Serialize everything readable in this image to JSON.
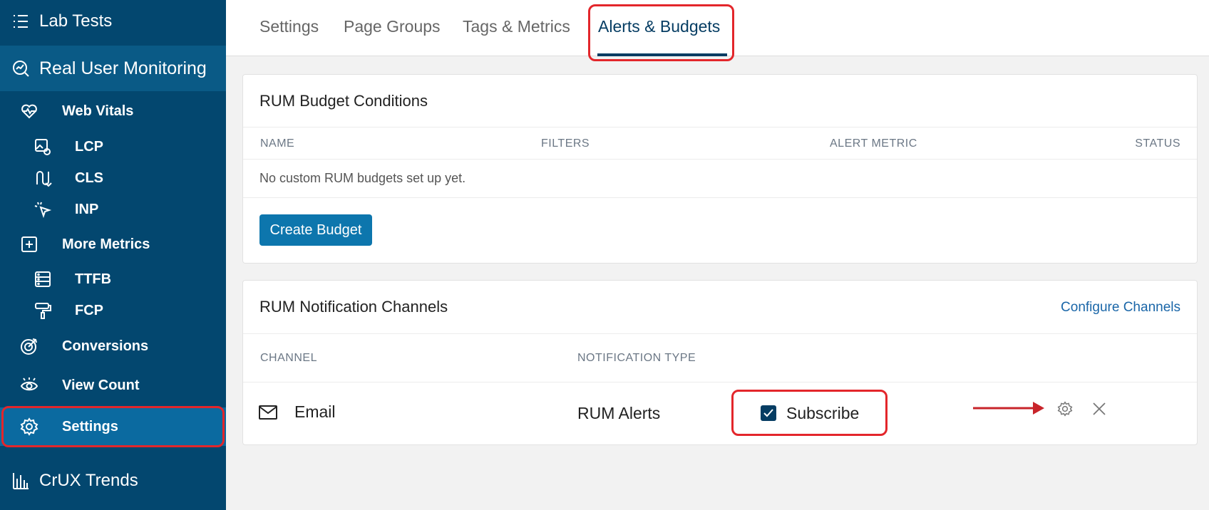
{
  "sidebar": {
    "lab_tests": "Lab Tests",
    "rum": "Real User Monitoring",
    "web_vitals": "Web Vitals",
    "lcp": "LCP",
    "cls": "CLS",
    "inp": "INP",
    "more_metrics": "More Metrics",
    "ttfb": "TTFB",
    "fcp": "FCP",
    "conversions": "Conversions",
    "view_count": "View Count",
    "settings": "Settings",
    "crux_trends": "CrUX Trends"
  },
  "tabs": {
    "settings": "Settings",
    "page_groups": "Page Groups",
    "tags_metrics": "Tags & Metrics",
    "alerts_budgets": "Alerts & Budgets"
  },
  "budget": {
    "title": "RUM Budget Conditions",
    "col_name": "NAME",
    "col_filters": "FILTERS",
    "col_alert_metric": "ALERT METRIC",
    "col_status": "STATUS",
    "empty": "No custom RUM budgets set up yet.",
    "create_label": "Create Budget"
  },
  "channels": {
    "title": "RUM Notification Channels",
    "configure_label": "Configure Channels",
    "col_channel": "CHANNEL",
    "col_type": "NOTIFICATION TYPE",
    "row": {
      "channel": "Email",
      "type": "RUM Alerts",
      "subscribe_label": "Subscribe",
      "subscribed": true
    }
  },
  "colors": {
    "sidebar_bg": "#03476f",
    "sidebar_active": "#0b6aa0",
    "accent": "#063d63",
    "primary_button": "#0d76ad",
    "highlight": "#e3262b"
  }
}
